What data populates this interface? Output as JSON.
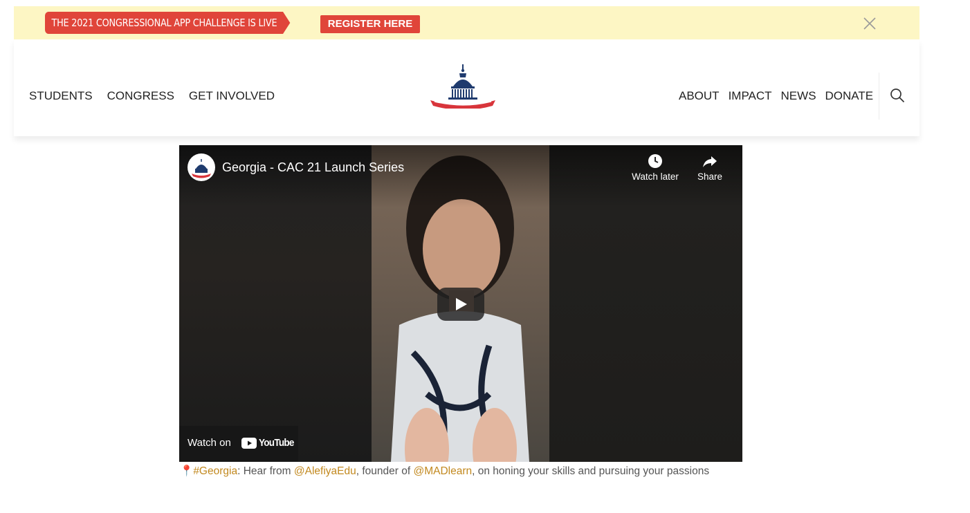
{
  "banner": {
    "tag_text": "THE 2021 CONGRESSIONAL APP CHALLENGE IS LIVE",
    "button_label": "REGISTER HERE",
    "close_icon": "close-icon",
    "colors": {
      "background": "#fdf6c4",
      "accent": "#e0453a"
    }
  },
  "nav": {
    "left_items": [
      {
        "label": "STUDENTS"
      },
      {
        "label": "CONGRESS"
      },
      {
        "label": "GET INVOLVED"
      }
    ],
    "right_items": [
      {
        "label": "ABOUT"
      },
      {
        "label": "IMPACT"
      },
      {
        "label": "NEWS"
      },
      {
        "label": "DONATE"
      }
    ],
    "logo_icon": "capitol-dome-logo",
    "search_icon": "search-icon"
  },
  "video": {
    "title": "Georgia - CAC 21 Launch Series",
    "watch_later_label": "Watch later",
    "share_label": "Share",
    "watch_on_label": "Watch on",
    "youtube_label": "YouTube",
    "play_icon": "play-icon"
  },
  "caption": {
    "pin_icon": "📍",
    "hashtag": "#Georgia",
    "text_1": ": Hear from ",
    "mention_1": "@AlefiyaEdu",
    "text_2": ", founder of ",
    "mention_2": "@MADlearn",
    "text_3": ", on honing your skills and pursuing your passions",
    "link_color": "#c2891f"
  }
}
